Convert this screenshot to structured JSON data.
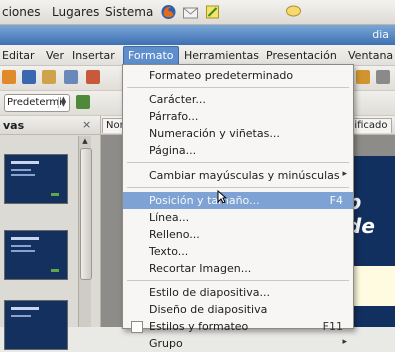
{
  "panel": {
    "menus": [
      "ciones",
      "Lugares",
      "Sistema"
    ]
  },
  "window": {
    "title": "dia"
  },
  "menubar": {
    "items": [
      "Editar",
      "Ver",
      "Insertar",
      "Formato",
      "Herramientas",
      "Presentación",
      "Ventana"
    ],
    "active": "Formato"
  },
  "toolbar": {
    "style_combo": "Predetermi"
  },
  "slides_pane": {
    "title": "vas",
    "close": "×"
  },
  "editor": {
    "tab_normal": "Nor",
    "tab_sorter": "asificado",
    "slide_text": "p de"
  },
  "format_menu": {
    "items": [
      {
        "label": "Formateo predeterminado",
        "shortcut": "",
        "submenu": false,
        "highlighted": false
      },
      {
        "label": "Carácter...",
        "shortcut": "",
        "submenu": false,
        "highlighted": false
      },
      {
        "label": "Párrafo...",
        "shortcut": "",
        "submenu": false,
        "highlighted": false
      },
      {
        "label": "Numeración y viñetas...",
        "shortcut": "",
        "submenu": false,
        "highlighted": false
      },
      {
        "label": "Página...",
        "shortcut": "",
        "submenu": false,
        "highlighted": false
      },
      {
        "label": "Cambiar mayúsculas y minúsculas",
        "shortcut": "",
        "submenu": true,
        "highlighted": false
      },
      {
        "label": "Posición y tamaño...",
        "shortcut": "F4",
        "submenu": false,
        "highlighted": true
      },
      {
        "label": "Línea...",
        "shortcut": "",
        "submenu": false,
        "highlighted": false
      },
      {
        "label": "Relleno...",
        "shortcut": "",
        "submenu": false,
        "highlighted": false
      },
      {
        "label": "Texto...",
        "shortcut": "",
        "submenu": false,
        "highlighted": false
      },
      {
        "label": "Recortar Imagen...",
        "shortcut": "",
        "submenu": false,
        "highlighted": false
      },
      {
        "label": "Estilo de diapositiva...",
        "shortcut": "",
        "submenu": false,
        "highlighted": false
      },
      {
        "label": "Diseño de diapositiva",
        "shortcut": "",
        "submenu": false,
        "highlighted": false
      },
      {
        "label": "Estilos y formateo",
        "shortcut": "F11",
        "submenu": false,
        "highlighted": false,
        "checkbox": true
      },
      {
        "label": "Grupo",
        "shortcut": "",
        "submenu": true,
        "highlighted": false
      }
    ]
  },
  "colors": {
    "highlight": "#7ea2d3",
    "menubar_active": "#5e8fcc",
    "titlebar": "#3e70b2",
    "slide_bg": "#12305f"
  }
}
